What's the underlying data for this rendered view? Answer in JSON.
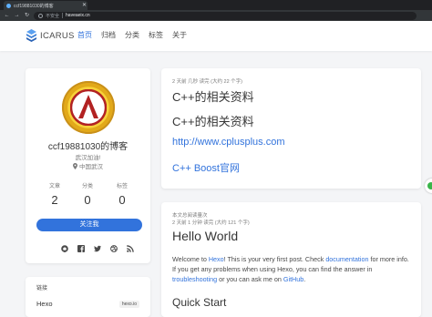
{
  "browser": {
    "tab_title": "ccf19881030的博客",
    "tab_close": "✕",
    "security_label": "不安全",
    "url": "haveaeix.cn",
    "back": "←",
    "forward": "→",
    "reload": "↻"
  },
  "site": {
    "logo_text": "ICARUS",
    "nav": [
      "首页",
      "归档",
      "分类",
      "标签",
      "关于"
    ],
    "accent_color": "#3273dc"
  },
  "profile": {
    "name": "ccf19881030的博客",
    "title": "武汉加油!",
    "location": "中国武汉",
    "stats": [
      {
        "label": "文章",
        "value": "2"
      },
      {
        "label": "分类",
        "value": "0"
      },
      {
        "label": "标签",
        "value": "0"
      }
    ],
    "follow_label": "关注我",
    "socials": [
      "github-icon",
      "facebook-icon",
      "twitter-icon",
      "dribbble-icon",
      "rss-icon"
    ]
  },
  "links": {
    "heading": "链接",
    "items": [
      {
        "name": "Hexo",
        "tag": "hexo.io"
      }
    ]
  },
  "posts": [
    {
      "meta": "2 天前   几秒 读完 (大约 22 个字)",
      "title": "C++的相关资料",
      "heading": "C++的相关资料",
      "link1": "http://www.cplusplus.com",
      "link2": "C++ Boost官网"
    },
    {
      "meta": "本文总阅读量次",
      "meta2": "2 天前   1 分钟 读完 (大约 121 个字)",
      "title": "Hello World",
      "body_1": "Welcome to ",
      "body_link1": "Hexo",
      "body_2": "! This is your very first post. Check ",
      "body_link2": "documentation",
      "body_3": " for more info. If you get any problems when using Hexo, you can find the answer in ",
      "body_link3": "troubleshooting",
      "body_4": " or you can ask me on ",
      "body_link4": "GitHub",
      "body_5": ".",
      "section_heading": "Quick Start"
    }
  ]
}
